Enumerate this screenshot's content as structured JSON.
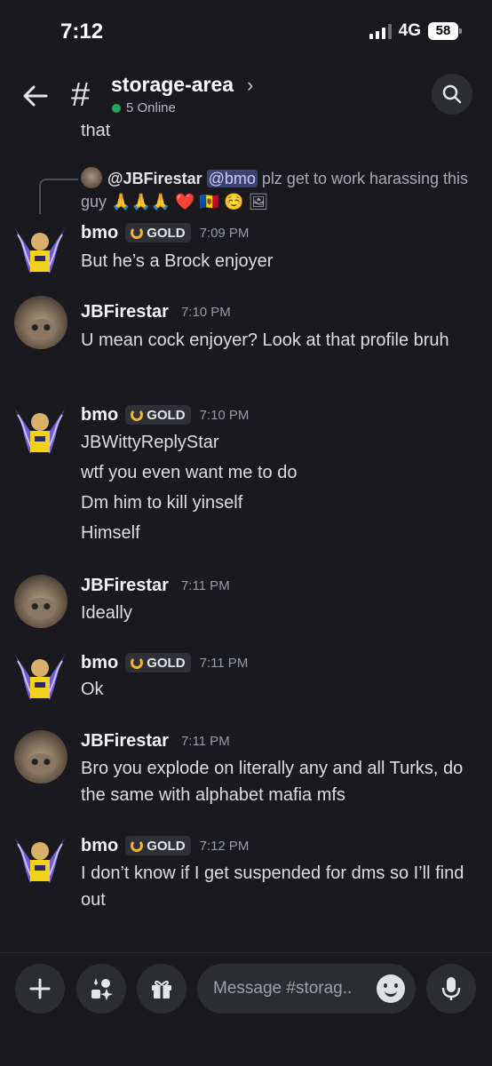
{
  "status_bar": {
    "time": "7:12",
    "network": "4G",
    "battery": "58"
  },
  "header": {
    "channel": "storage-area",
    "online": "5 Online"
  },
  "cutoff_text": "that",
  "reply": {
    "author": "@JBFirestar",
    "mention": "@bmo",
    "text": " plz get to work harassing this guy ",
    "emojis": "🙏🙏🙏 ❤️ 🇲🇩 ☺️ 🖼"
  },
  "messages": [
    {
      "author": "bmo",
      "badge": "GOLD",
      "time": "7:09 PM",
      "lines": [
        "But he’s a Brock enjoyer"
      ]
    },
    {
      "author": "JBFirestar",
      "time": "7:10 PM",
      "lines": [
        "U mean cock enjoyer? Look at that profile bruh"
      ]
    },
    {
      "author": "bmo",
      "badge": "GOLD",
      "time": "7:10 PM",
      "lines": [
        "JBWittyReplyStar",
        "wtf you even want me to do",
        "Dm him to kill yinself",
        "Himself"
      ]
    },
    {
      "author": "JBFirestar",
      "time": "7:11 PM",
      "lines": [
        "Ideally"
      ]
    },
    {
      "author": "bmo",
      "badge": "GOLD",
      "time": "7:11 PM",
      "lines": [
        "Ok"
      ]
    },
    {
      "author": "JBFirestar",
      "time": "7:11 PM",
      "lines": [
        "Bro you explode on literally any and all Turks, do the same with alphabet mafia mfs"
      ]
    },
    {
      "author": "bmo",
      "badge": "GOLD",
      "time": "7:12 PM",
      "lines": [
        "I don’t know if I get suspended for dms so I’ll find out"
      ]
    }
  ],
  "composer": {
    "placeholder": "Message #storag.."
  },
  "colors": {
    "background": "#1a1a1e",
    "online": "#23a55a",
    "gold": "#f0b232",
    "mention_bg": "#3c4270"
  }
}
